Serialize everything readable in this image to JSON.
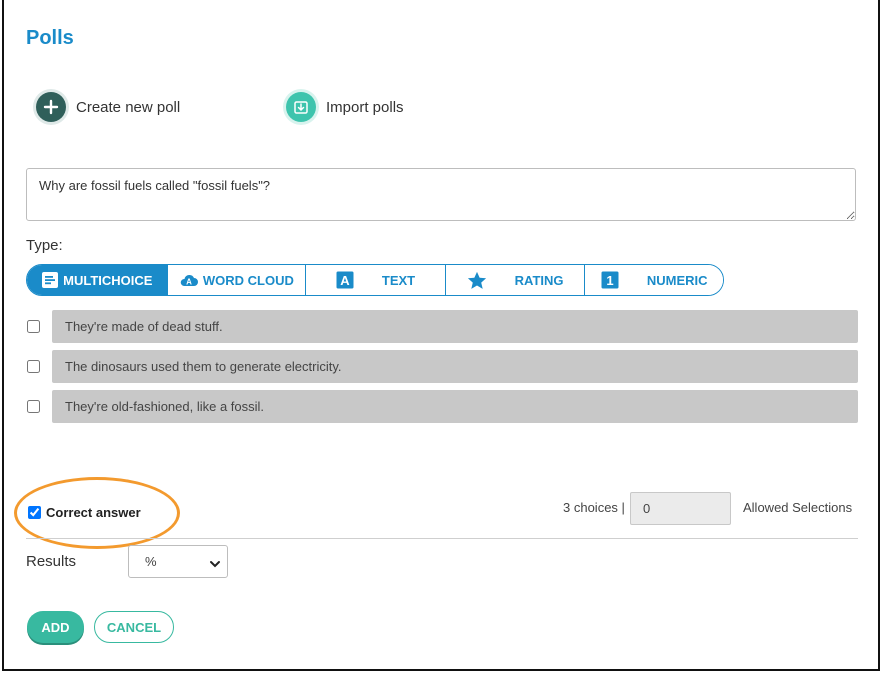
{
  "header": {
    "title": "Polls"
  },
  "actions": {
    "create_label": "Create new poll",
    "import_label": "Import polls"
  },
  "question": {
    "value": "Why are fossil fuels called \"fossil fuels\"?"
  },
  "type_section": {
    "label": "Type:",
    "types": [
      {
        "label": "MULTICHOICE",
        "icon": "list-icon",
        "active": true
      },
      {
        "label": "WORD CLOUD",
        "icon": "cloud-icon",
        "active": false
      },
      {
        "label": "TEXT",
        "icon": "text-a-icon",
        "active": false
      },
      {
        "label": "RATING",
        "icon": "star-icon",
        "active": false
      },
      {
        "label": "NUMERIC",
        "icon": "number-one-icon",
        "active": false
      }
    ]
  },
  "choices": [
    {
      "text": "They're made of dead stuff.",
      "checked": false
    },
    {
      "text": "The dinosaurs used them to generate electricity.",
      "checked": false
    },
    {
      "text": "They're old-fashioned, like a fossil.",
      "checked": false
    }
  ],
  "options": {
    "correct_answer_label": "Correct answer",
    "correct_answer_checked": true,
    "choices_count": "3 choices |",
    "allowed_value": "0",
    "allowed_label": "Allowed Selections"
  },
  "results": {
    "label": "Results",
    "selected": "%"
  },
  "buttons": {
    "add": "ADD",
    "cancel": "CANCEL"
  },
  "colors": {
    "brand_blue": "#1a8bc9",
    "teal": "#38b9a0",
    "dark_teal": "#2f5f5a",
    "highlight_orange": "#f39a2e"
  }
}
